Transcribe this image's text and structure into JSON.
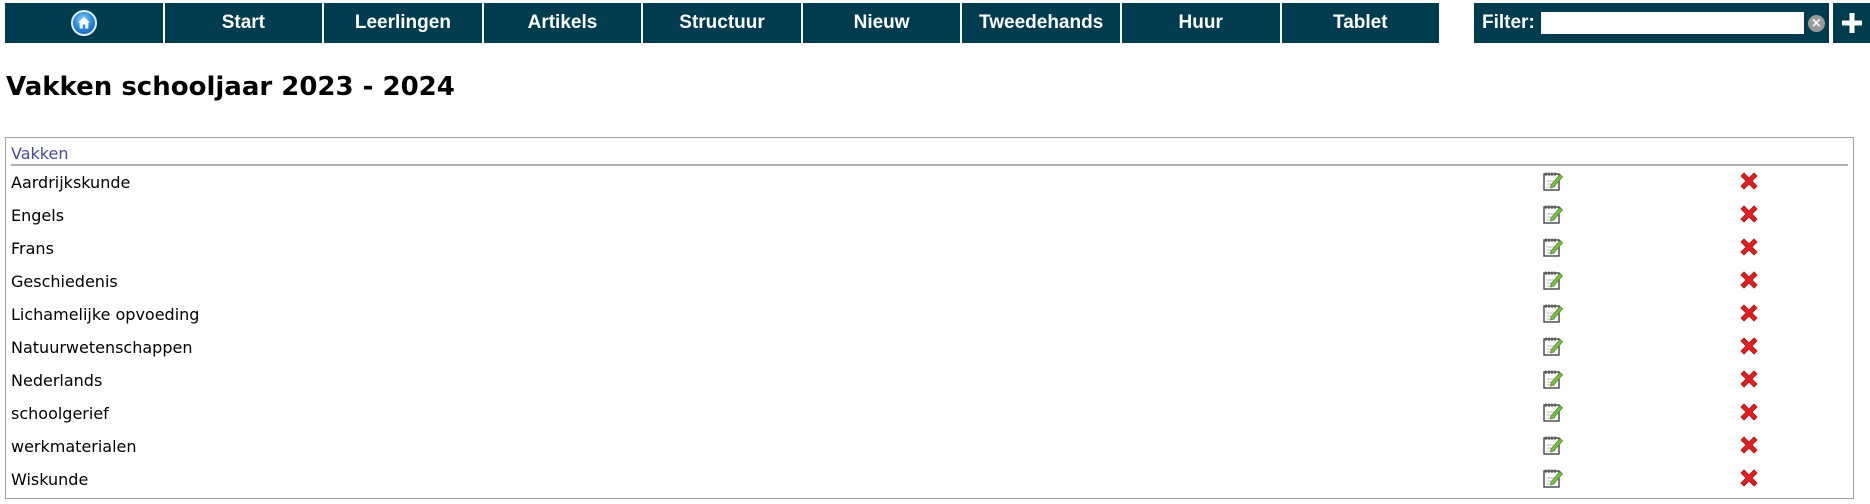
{
  "nav": {
    "home_icon": "home-icon",
    "items": [
      {
        "label": "Start"
      },
      {
        "label": "Leerlingen"
      },
      {
        "label": "Artikels"
      },
      {
        "label": "Structuur"
      },
      {
        "label": "Nieuw"
      },
      {
        "label": "Tweedehands"
      },
      {
        "label": "Huur"
      },
      {
        "label": "Tablet"
      }
    ]
  },
  "filter": {
    "label": "Filter:",
    "value": "",
    "clear_icon": "clear-icon",
    "clear_symbol": "×"
  },
  "add_button_icon": "plus-icon",
  "page_title": "Vakken schooljaar 2023 - 2024",
  "table": {
    "header": "Vakken",
    "edit_icon": "edit-icon",
    "delete_icon": "delete-icon",
    "rows": [
      {
        "name": "Aardrijkskunde"
      },
      {
        "name": "Engels"
      },
      {
        "name": "Frans"
      },
      {
        "name": "Geschiedenis"
      },
      {
        "name": "Lichamelijke opvoeding"
      },
      {
        "name": "Natuurwetenschappen"
      },
      {
        "name": "Nederlands"
      },
      {
        "name": "schoolgerief"
      },
      {
        "name": "werkmaterialen"
      },
      {
        "name": "Wiskunde"
      }
    ]
  },
  "colors": {
    "nav_bg": "#003c50",
    "header_text": "#4a4a9a",
    "delete_red": "#e02020",
    "edit_green": "#5aa02c"
  }
}
